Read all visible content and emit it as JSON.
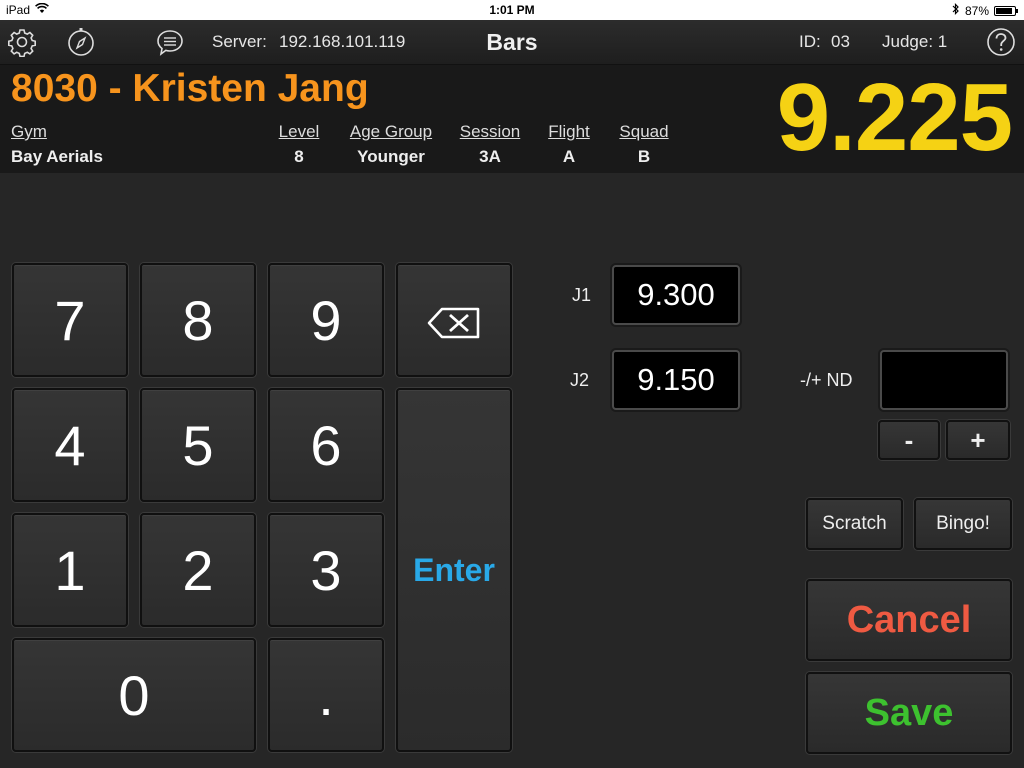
{
  "status_bar": {
    "device": "iPad",
    "time": "1:01 PM",
    "battery": "87%"
  },
  "toolbar": {
    "server_label": "Server:",
    "server_ip": "192.168.101.119",
    "title": "Bars",
    "id_label": "ID:",
    "id_value": "03",
    "judge_label": "Judge: 1",
    "icons": [
      "gear-icon",
      "compass-icon",
      "chat-icon",
      "help-icon"
    ]
  },
  "athlete": {
    "name": "8030 - Kristen Jang",
    "score": "9.225",
    "fields": [
      {
        "label": "Gym",
        "value": "Bay Aerials"
      },
      {
        "label": "Level",
        "value": "8"
      },
      {
        "label": "Age Group",
        "value": "Younger"
      },
      {
        "label": "Session",
        "value": "3A"
      },
      {
        "label": "Flight",
        "value": "A"
      },
      {
        "label": "Squad",
        "value": "B"
      }
    ]
  },
  "keypad": {
    "keys": [
      "7",
      "8",
      "9",
      "4",
      "5",
      "6",
      "1",
      "2",
      "3",
      "0",
      "."
    ],
    "backspace": "⌫",
    "enter": "Enter"
  },
  "judges": [
    {
      "label": "J1",
      "score": "9.300"
    },
    {
      "label": "J2",
      "score": "9.150"
    }
  ],
  "nd": {
    "label": "-/+ ND",
    "value": "",
    "minus": "-",
    "plus": "+"
  },
  "actions": {
    "scratch": "Scratch",
    "bingo": "Bingo!",
    "cancel": "Cancel",
    "save": "Save"
  },
  "colors": {
    "name": "#f7941d",
    "score": "#f5d214",
    "enter": "#29a9e8",
    "cancel": "#ef5a42",
    "save": "#3dc12f"
  }
}
